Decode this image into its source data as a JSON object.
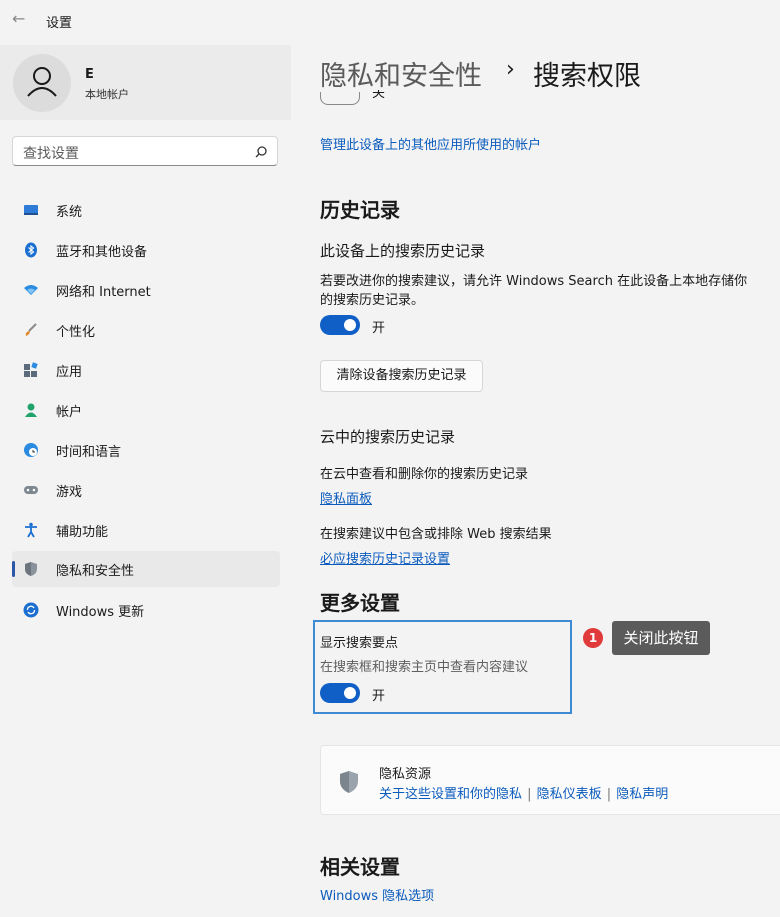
{
  "titlebar": {
    "back_glyph": "←",
    "title": "设置"
  },
  "account": {
    "name": "E",
    "type": "本地帐户"
  },
  "search": {
    "placeholder": "查找设置"
  },
  "sidebar": {
    "items": [
      {
        "label": "系统",
        "icon": "system-icon",
        "active": false
      },
      {
        "label": "蓝牙和其他设备",
        "icon": "bluetooth-icon",
        "active": false
      },
      {
        "label": "网络和 Internet",
        "icon": "wifi-icon",
        "active": false
      },
      {
        "label": "个性化",
        "icon": "brush-icon",
        "active": false
      },
      {
        "label": "应用",
        "icon": "apps-icon",
        "active": false
      },
      {
        "label": "帐户",
        "icon": "account-icon",
        "active": false
      },
      {
        "label": "时间和语言",
        "icon": "globe-clock-icon",
        "active": false
      },
      {
        "label": "游戏",
        "icon": "gamepad-icon",
        "active": false
      },
      {
        "label": "辅助功能",
        "icon": "accessibility-icon",
        "active": false
      },
      {
        "label": "隐私和安全性",
        "icon": "shield-icon",
        "active": true
      },
      {
        "label": "Windows 更新",
        "icon": "update-icon",
        "active": false
      }
    ]
  },
  "header": {
    "parent": "隐私和安全性",
    "separator": "›",
    "current": "搜索权限"
  },
  "partial_toggle_label": "关",
  "manage_accounts_link": "管理此设备上的其他应用所使用的帐户",
  "history": {
    "title": "历史记录",
    "device_title": "此设备上的搜索历史记录",
    "device_desc_1": "若要改进你的搜索建议，请允许 Windows Search 在此设备上本地存储你",
    "device_desc_2": "的搜索历史记录。",
    "device_toggle_label": "开",
    "clear_button": "清除设备搜索历史记录",
    "cloud_title": "云中的搜索历史记录",
    "cloud_desc": "在云中查看和删除你的搜索历史记录",
    "privacy_dashboard_link": "隐私面板",
    "web_desc": "在搜索建议中包含或排除 Web 搜索结果",
    "bing_link": "必应搜索历史记录设置"
  },
  "more": {
    "title": "更多设置",
    "highlights_title": "显示搜索要点",
    "highlights_desc": "在搜索框和搜索主页中查看内容建议",
    "highlights_toggle_label": "开"
  },
  "annotation": {
    "number": "1",
    "text": "关闭此按钮"
  },
  "privacy_resources": {
    "title": "隐私资源",
    "link1": "关于这些设置和你的隐私",
    "link2": "隐私仪表板",
    "link3": "隐私声明",
    "divider": "|"
  },
  "related": {
    "title": "相关设置",
    "link": "Windows 隐私选项"
  },
  "colors": {
    "accent": "#0f5fc6",
    "link": "#0b5bbd",
    "highlight_border": "#3f8bd3",
    "badge": "#e13a3a"
  }
}
